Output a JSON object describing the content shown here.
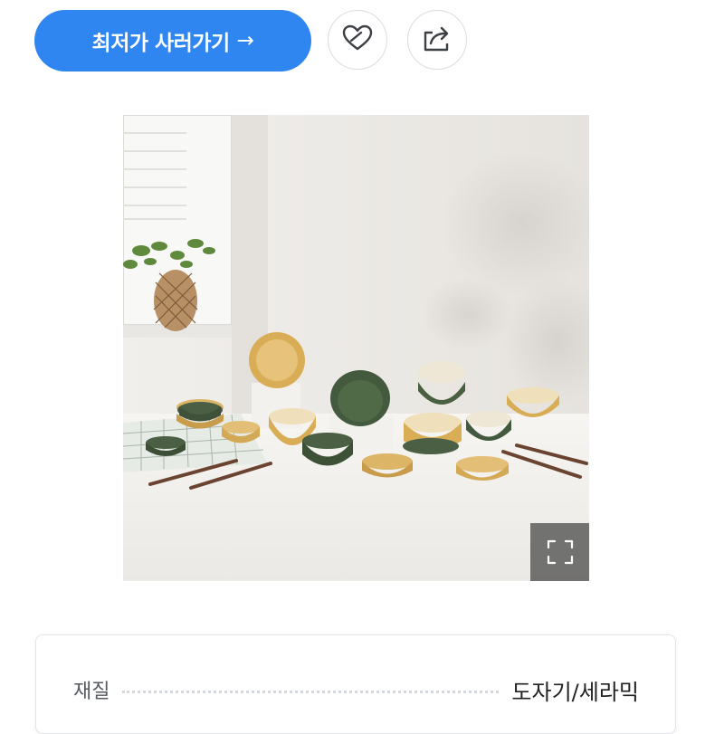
{
  "actions": {
    "buy_label": "최저가 사러가기",
    "buy_arrow": "→",
    "wish_icon": "heart-icon",
    "share_icon": "share-icon"
  },
  "product_image": {
    "expand_icon": "expand-icon"
  },
  "spec": {
    "rows": [
      {
        "label": "재질",
        "value": "도자기/세라믹"
      }
    ]
  },
  "colors": {
    "accent": "#2f86f0",
    "button_border": "#d9dce1"
  }
}
